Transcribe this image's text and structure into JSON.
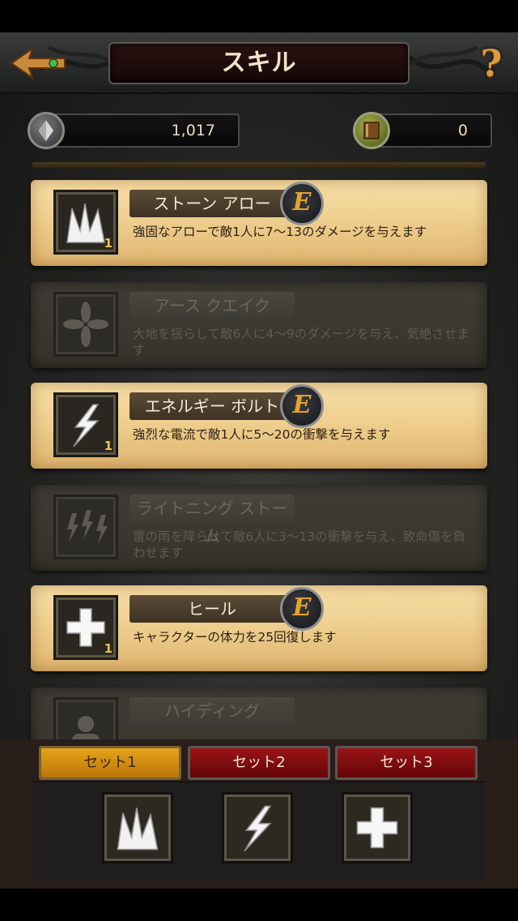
{
  "header": {
    "title": "スキル",
    "help_label": "?"
  },
  "currencies": {
    "gems": "1,017",
    "books": "0"
  },
  "skills": [
    {
      "name": "ストーン アロー",
      "desc": "強固なアローで敵1人に7～13のダメージを与えます",
      "level": "1",
      "equipped_label": "E",
      "locked": false,
      "icon": "stone-arrow-icon"
    },
    {
      "name": "アース クエイク",
      "desc": "大地を揺らして敵6人に4～9のダメージを与え、気絶させます",
      "level": "",
      "locked": true,
      "icon": "earthquake-icon"
    },
    {
      "name": "エネルギー ボルト",
      "desc": "強烈な電流で敵1人に5～20の衝撃を与えます",
      "level": "1",
      "equipped_label": "E",
      "locked": false,
      "icon": "energy-bolt-icon"
    },
    {
      "name": "ライトニング ストーム",
      "desc": "雷の雨を降らせて敵6人に3～13の衝撃を与え、致命傷を負わせます",
      "level": "",
      "locked": true,
      "icon": "lightning-storm-icon"
    },
    {
      "name": "ヒール",
      "desc": "キャラクターの体力を25回復します",
      "level": "1",
      "equipped_label": "E",
      "locked": false,
      "icon": "heal-icon"
    },
    {
      "name": "ハイディング",
      "desc": "",
      "level": "",
      "locked": true,
      "icon": "hiding-icon"
    }
  ],
  "sets": [
    {
      "label": "セット1",
      "active": true
    },
    {
      "label": "セット2",
      "active": false
    },
    {
      "label": "セット3",
      "active": false
    }
  ],
  "slots": [
    {
      "icon": "stone-arrow-icon"
    },
    {
      "icon": "energy-bolt-icon"
    },
    {
      "icon": "heal-icon"
    }
  ],
  "colors": {
    "accent_gold": "#e7a22b",
    "tab_active": "#e6a519",
    "tab_inactive": "#9a1416",
    "parchment": "#efcf8f"
  }
}
